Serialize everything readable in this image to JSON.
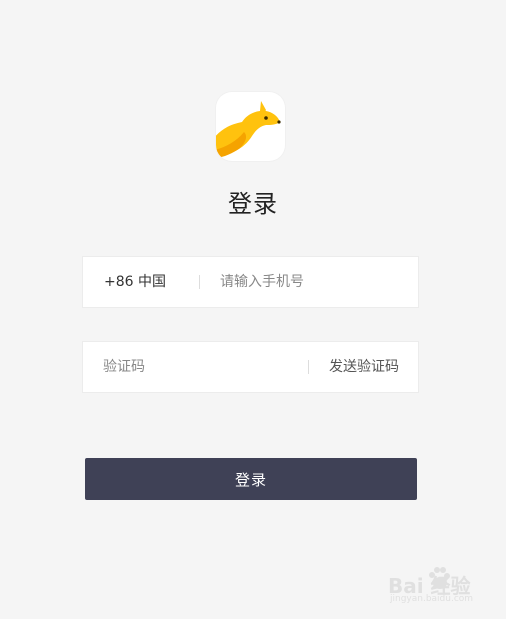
{
  "page": {
    "title": "登录"
  },
  "phone_field": {
    "country_code": "+86 中国",
    "placeholder": "请输入手机号",
    "value": ""
  },
  "code_field": {
    "placeholder": "验证码",
    "value": "",
    "send_code_label": "发送验证码"
  },
  "login_button": {
    "label": "登录"
  },
  "watermark": {
    "text": "Bai  经验",
    "sub": "jingyan.baidu.com"
  },
  "colors": {
    "background": "#f5f5f5",
    "button": "#3f4156",
    "logo_yellow": "#ffc20e"
  },
  "icons": {
    "logo": "kangaroo-logo-icon",
    "watermark": "baidu-paw-icon"
  }
}
